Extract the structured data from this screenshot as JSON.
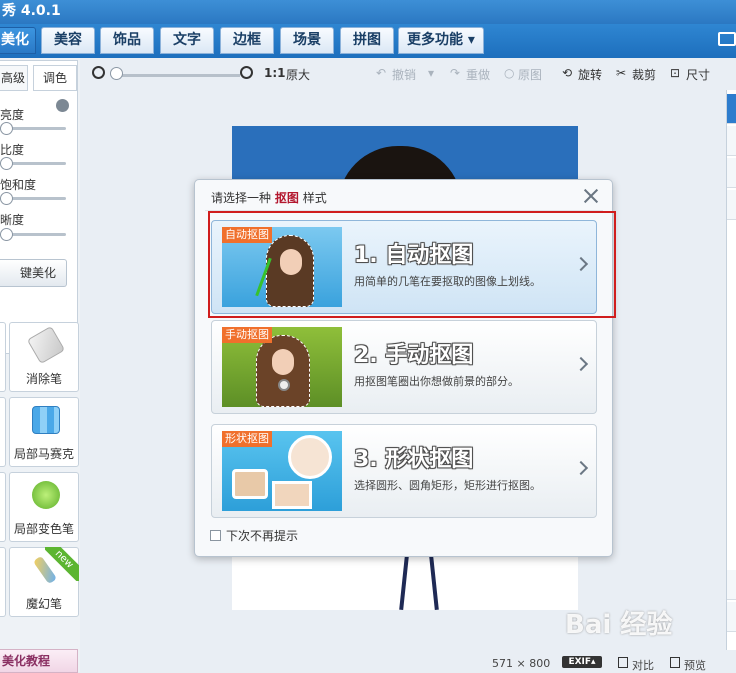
{
  "app": {
    "title": "秀 4.0.1"
  },
  "tabs": [
    {
      "label": "美化",
      "active": true
    },
    {
      "label": "美容"
    },
    {
      "label": "饰品"
    },
    {
      "label": "文字"
    },
    {
      "label": "边框"
    },
    {
      "label": "场景"
    },
    {
      "label": "拼图"
    },
    {
      "label": "更多功能 ▾"
    }
  ],
  "left": {
    "subtabs": [
      "高级",
      "调色"
    ],
    "sliders": [
      {
        "label": "亮度",
        "level": 0
      },
      {
        "label": "比度",
        "level": 0
      },
      {
        "label": "饱和度",
        "level": 0
      },
      {
        "label": "晰度",
        "level": 0
      }
    ],
    "one_click": "键美化",
    "tools": [
      {
        "label": "消除笔",
        "icon": "eraser-icon"
      },
      {
        "label": "局部马赛克",
        "icon": "mosaic-icon"
      },
      {
        "label": "局部变色笔",
        "icon": "color-brush-icon"
      },
      {
        "label": "魔幻笔",
        "icon": "magic-pen-icon",
        "badge": "new"
      }
    ],
    "tutorial": "美化教程"
  },
  "toolbar": {
    "ratio": "1:1",
    "original_size": "原大",
    "undo": "撤销",
    "redo": "重做",
    "original": "原图",
    "rotate": "旋转",
    "crop": "裁剪",
    "size": "尺寸"
  },
  "dialog": {
    "title_prefix": "请选择一种",
    "title_emph": "抠图",
    "title_suffix": "样式",
    "options": [
      {
        "tag": "自动抠图",
        "title": "1. 自动抠图",
        "desc": "用简单的几笔在要抠取的图像上划线。",
        "highlighted": true
      },
      {
        "tag": "手动抠图",
        "title": "2. 手动抠图",
        "desc": "用抠图笔圈出你想做前景的部分。"
      },
      {
        "tag": "形状抠图",
        "title": "3. 形状抠图",
        "desc": "选择圆形、圆角矩形，矩形进行抠图。"
      }
    ],
    "dont_show": "下次不再提示"
  },
  "status": {
    "dimensions": "571 × 800",
    "exif": "EXIF▴",
    "compare": "对比",
    "preview": "预览"
  },
  "watermark": "Bai 经验",
  "colors": {
    "accent": "#2b78c2",
    "highlight_box": "#d01d1d",
    "tag": "#f0702c"
  }
}
